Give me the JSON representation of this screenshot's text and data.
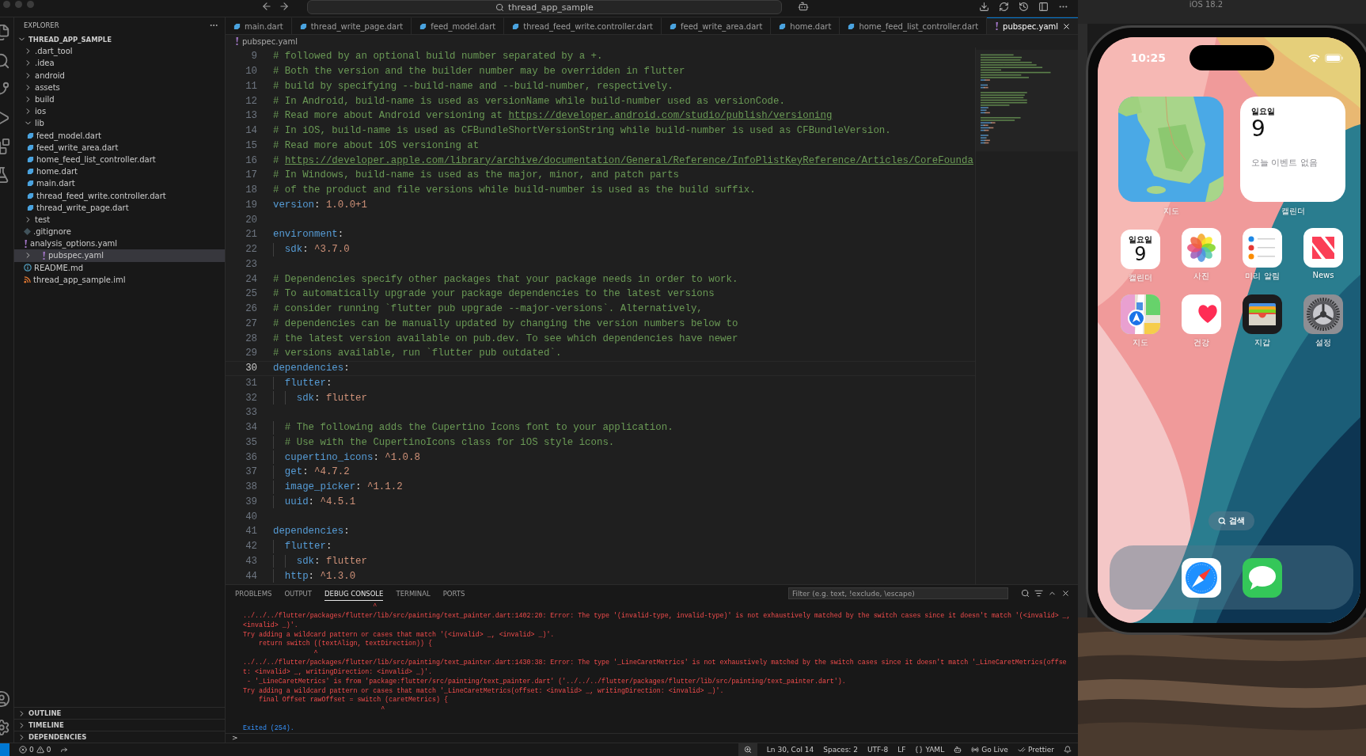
{
  "titlebar": {
    "search": "thread_app_sample"
  },
  "sidebar": {
    "title": "EXPLORER",
    "tree": [
      {
        "label": "THREAD_APP_SAMPLE",
        "kind": "root",
        "expanded": true,
        "selected": false,
        "children": [
          {
            "label": ".dart_tool",
            "kind": "folder",
            "expanded": false,
            "selected": false
          },
          {
            "label": ".idea",
            "kind": "folder",
            "expanded": false,
            "selected": false
          },
          {
            "label": "android",
            "kind": "folder",
            "expanded": false,
            "selected": false
          },
          {
            "label": "assets",
            "kind": "folder",
            "expanded": false,
            "selected": false
          },
          {
            "label": "build",
            "kind": "folder",
            "expanded": false,
            "selected": false
          },
          {
            "label": "ios",
            "kind": "folder",
            "expanded": false,
            "selected": false
          },
          {
            "label": "lib",
            "kind": "folder",
            "expanded": true,
            "selected": false,
            "children": [
              {
                "label": "feed_model.dart",
                "kind": "dart",
                "selected": false
              },
              {
                "label": "feed_write_area.dart",
                "kind": "dart",
                "selected": false
              },
              {
                "label": "home_feed_list_controller.dart",
                "kind": "dart",
                "selected": false
              },
              {
                "label": "home.dart",
                "kind": "dart",
                "selected": false
              },
              {
                "label": "main.dart",
                "kind": "dart",
                "selected": false
              },
              {
                "label": "thread_feed_write.controller.dart",
                "kind": "dart",
                "selected": false
              },
              {
                "label": "thread_write_page.dart",
                "kind": "dart",
                "selected": false
              }
            ]
          },
          {
            "label": "test",
            "kind": "folder",
            "expanded": false,
            "selected": false
          },
          {
            "label": ".gitignore",
            "kind": "git",
            "selected": false
          },
          {
            "label": "analysis_options.yaml",
            "kind": "yaml",
            "selected": false
          },
          {
            "label": "pubspec.yaml",
            "kind": "yaml",
            "expanded": false,
            "selected": true
          },
          {
            "label": "README.md",
            "kind": "info",
            "selected": false
          },
          {
            "label": "thread_app_sample.iml",
            "kind": "iml",
            "selected": false
          }
        ]
      }
    ],
    "sections": [
      {
        "label": "OUTLINE",
        "expanded": false
      },
      {
        "label": "TIMELINE",
        "expanded": false
      },
      {
        "label": "DEPENDENCIES",
        "expanded": false
      }
    ]
  },
  "tabs": [
    {
      "label": "main.dart",
      "kind": "dart",
      "selected": false
    },
    {
      "label": "thread_write_page.dart",
      "kind": "dart",
      "selected": false
    },
    {
      "label": "feed_model.dart",
      "kind": "dart",
      "selected": false
    },
    {
      "label": "thread_feed_write.controller.dart",
      "kind": "dart",
      "selected": false
    },
    {
      "label": "feed_write_area.dart",
      "kind": "dart",
      "selected": false
    },
    {
      "label": "home.dart",
      "kind": "dart",
      "selected": false
    },
    {
      "label": "home_feed_list_controller.dart",
      "kind": "dart",
      "selected": false
    },
    {
      "label": "pubspec.yaml",
      "kind": "yaml",
      "selected": true
    }
  ],
  "breadcrumb": [
    {
      "label": "pubspec.yaml",
      "kind": "yaml"
    }
  ],
  "editor": {
    "lines": [
      {
        "number": "9",
        "current": false,
        "tokens": [
          {
            "kind": "comment",
            "text": "# followed by an optional build number separated by a +."
          }
        ]
      },
      {
        "number": "10",
        "current": false,
        "tokens": [
          {
            "kind": "comment",
            "text": "# Both the version and the builder number may be overridden in flutter"
          }
        ]
      },
      {
        "number": "11",
        "current": false,
        "tokens": [
          {
            "kind": "comment",
            "text": "# build by specifying --build-name and --build-number, respectively."
          }
        ]
      },
      {
        "number": "12",
        "current": false,
        "tokens": [
          {
            "kind": "comment",
            "text": "# In Android, build-name is used as versionName while build-number used as versionCode."
          }
        ]
      },
      {
        "number": "13",
        "current": false,
        "tokens": [
          {
            "kind": "comment",
            "text": "# Read more about Android versioning at "
          },
          {
            "kind": "link",
            "text": "https://developer.android.com/studio/publish/versioning"
          }
        ]
      },
      {
        "number": "14",
        "current": false,
        "tokens": [
          {
            "kind": "comment",
            "text": "# In iOS, build-name is used as CFBundleShortVersionString while build-number is used as CFBundleVersion."
          }
        ]
      },
      {
        "number": "15",
        "current": false,
        "tokens": [
          {
            "kind": "comment",
            "text": "# Read more about iOS versioning at"
          }
        ]
      },
      {
        "number": "16",
        "current": false,
        "tokens": [
          {
            "kind": "comment",
            "text": "# "
          },
          {
            "kind": "link",
            "text": "https://developer.apple.com/library/archive/documentation/General/Reference/InfoPlistKeyReference/Articles/CoreFounda"
          }
        ]
      },
      {
        "number": "17",
        "current": false,
        "tokens": [
          {
            "kind": "comment",
            "text": "# In Windows, build-name is used as the major, minor, and patch parts"
          }
        ]
      },
      {
        "number": "18",
        "current": false,
        "tokens": [
          {
            "kind": "comment",
            "text": "# of the product and file versions while build-number is used as the build suffix."
          }
        ]
      },
      {
        "number": "19",
        "current": false,
        "tokens": [
          {
            "kind": "key",
            "text": "version"
          },
          {
            "kind": "punct",
            "text": ": "
          },
          {
            "kind": "value",
            "text": "1.0.0+1"
          }
        ]
      },
      {
        "number": "20",
        "current": false
      },
      {
        "number": "21",
        "current": false,
        "tokens": [
          {
            "kind": "key",
            "text": "environment"
          },
          {
            "kind": "punct",
            "text": ":"
          }
        ]
      },
      {
        "number": "22",
        "current": false,
        "tokens": [
          {
            "kind": "key",
            "text": "  sdk"
          },
          {
            "kind": "punct",
            "text": ": "
          },
          {
            "kind": "value",
            "text": "^3.7.0"
          }
        ]
      },
      {
        "number": "23",
        "current": false
      },
      {
        "number": "24",
        "current": false,
        "tokens": [
          {
            "kind": "comment",
            "text": "# Dependencies specify other packages that your package needs in order to work."
          }
        ]
      },
      {
        "number": "25",
        "current": false,
        "tokens": [
          {
            "kind": "comment",
            "text": "# To automatically upgrade your package dependencies to the latest versions"
          }
        ]
      },
      {
        "number": "26",
        "current": false,
        "tokens": [
          {
            "kind": "comment",
            "text": "# consider running `flutter pub upgrade --major-versions`. Alternatively,"
          }
        ]
      },
      {
        "number": "27",
        "current": false,
        "tokens": [
          {
            "kind": "comment",
            "text": "# dependencies can be manually updated by changing the version numbers below to"
          }
        ]
      },
      {
        "number": "28",
        "current": false,
        "tokens": [
          {
            "kind": "comment",
            "text": "# the latest version available on pub.dev. To see which dependencies have newer"
          }
        ]
      },
      {
        "number": "29",
        "current": false,
        "tokens": [
          {
            "kind": "comment",
            "text": "# versions available, run `flutter pub outdated`."
          }
        ]
      },
      {
        "number": "30",
        "current": true,
        "tokens": [
          {
            "kind": "key",
            "text": "dependencies"
          },
          {
            "kind": "punct",
            "text": ":"
          }
        ]
      },
      {
        "number": "31",
        "current": false,
        "tokens": [
          {
            "kind": "key",
            "text": "  flutter"
          },
          {
            "kind": "punct",
            "text": ":"
          }
        ]
      },
      {
        "number": "32",
        "current": false,
        "tokens": [
          {
            "kind": "key",
            "text": "    sdk"
          },
          {
            "kind": "punct",
            "text": ": "
          },
          {
            "kind": "value",
            "text": "flutter"
          }
        ]
      },
      {
        "number": "33",
        "current": false
      },
      {
        "number": "34",
        "current": false,
        "tokens": [
          {
            "kind": "comment",
            "text": "  # The following adds the Cupertino Icons font to your application."
          }
        ]
      },
      {
        "number": "35",
        "current": false,
        "tokens": [
          {
            "kind": "comment",
            "text": "  # Use with the CupertinoIcons class for iOS style icons."
          }
        ]
      },
      {
        "number": "36",
        "current": false,
        "tokens": [
          {
            "kind": "key",
            "text": "  cupertino_icons"
          },
          {
            "kind": "punct",
            "text": ": "
          },
          {
            "kind": "value",
            "text": "^1.0.8"
          }
        ]
      },
      {
        "number": "37",
        "current": false,
        "tokens": [
          {
            "kind": "key",
            "text": "  get"
          },
          {
            "kind": "punct",
            "text": ": "
          },
          {
            "kind": "value",
            "text": "^4.7.2"
          }
        ]
      },
      {
        "number": "38",
        "current": false,
        "tokens": [
          {
            "kind": "key",
            "text": "  image_picker"
          },
          {
            "kind": "punct",
            "text": ": "
          },
          {
            "kind": "value",
            "text": "^1.1.2"
          }
        ]
      },
      {
        "number": "39",
        "current": false,
        "tokens": [
          {
            "kind": "key",
            "text": "  uuid"
          },
          {
            "kind": "punct",
            "text": ": "
          },
          {
            "kind": "value",
            "text": "^4.5.1"
          }
        ]
      },
      {
        "number": "40",
        "current": false
      },
      {
        "number": "41",
        "current": false,
        "tokens": [
          {
            "kind": "key",
            "text": "dependencies"
          },
          {
            "kind": "punct",
            "text": ":"
          }
        ]
      },
      {
        "number": "42",
        "current": false,
        "tokens": [
          {
            "kind": "key",
            "text": "  flutter"
          },
          {
            "kind": "punct",
            "text": ":"
          }
        ]
      },
      {
        "number": "43",
        "current": false,
        "tokens": [
          {
            "kind": "key",
            "text": "    sdk"
          },
          {
            "kind": "punct",
            "text": ": "
          },
          {
            "kind": "value",
            "text": "flutter"
          }
        ]
      },
      {
        "number": "44",
        "current": false,
        "tokens": [
          {
            "kind": "key",
            "text": "  http"
          },
          {
            "kind": "punct",
            "text": ": "
          },
          {
            "kind": "value",
            "text": "^1.3.0"
          }
        ]
      }
    ]
  },
  "panel": {
    "tabs": [
      {
        "label": "PROBLEMS",
        "selected": false
      },
      {
        "label": "OUTPUT",
        "selected": false
      },
      {
        "label": "DEBUG CONSOLE",
        "selected": true
      },
      {
        "label": "TERMINAL",
        "selected": false
      },
      {
        "label": "PORTS",
        "selected": false
      }
    ],
    "filter": {
      "placeholder": "Filter (e.g. text, !exclude, \\escape)"
    },
    "lines": [
      {
        "kind": "error",
        "text": "                                 ^"
      },
      {
        "kind": "error",
        "text": "../../../flutter/packages/flutter/lib/src/painting/text_painter.dart:1402:20: Error: The type '(invalid-type, invalid-type)' is not exhaustively matched by the switch cases since it doesn't match '(<invalid> _,"
      },
      {
        "kind": "error",
        "text": "<invalid> _)'."
      },
      {
        "kind": "error",
        "text": "Try adding a wildcard pattern or cases that match '(<invalid> _, <invalid> _)'."
      },
      {
        "kind": "error",
        "text": "    return switch ((textAlign, textDirection)) {"
      },
      {
        "kind": "error",
        "text": "                  ^"
      },
      {
        "kind": "error",
        "text": "../../../flutter/packages/flutter/lib/src/painting/text_painter.dart:1430:38: Error: The type '_LineCaretMetrics' is not exhaustively matched by the switch cases since it doesn't match '_LineCaretMetrics(offse"
      },
      {
        "kind": "error",
        "text": "t: <invalid> _, writingDirection: <invalid> _)'."
      },
      {
        "kind": "error",
        "text": " - '_LineCaretMetrics' is from 'package:flutter/src/painting/text_painter.dart' ('../../../flutter/packages/flutter/lib/src/painting/text_painter.dart')."
      },
      {
        "kind": "error",
        "text": "Try adding a wildcard pattern or cases that match '_LineCaretMetrics(offset: <invalid> _, writingDirection: <invalid> _)'."
      },
      {
        "kind": "error",
        "text": "    final Offset rawOffset = switch (caretMetrics) {"
      },
      {
        "kind": "error",
        "text": "                                   ^"
      },
      {
        "kind": "blank"
      },
      {
        "kind": "info",
        "text": "Exited (254)."
      }
    ],
    "prompt": ">"
  },
  "status_bar": {
    "errors": "0",
    "warnings": "0",
    "items": [
      {
        "kind": "plain",
        "text": "Ln 30, Col 14"
      },
      {
        "kind": "plain",
        "text": "Spaces: 2"
      },
      {
        "kind": "plain",
        "text": "UTF-8"
      },
      {
        "kind": "plain",
        "text": "LF"
      },
      {
        "kind": "language",
        "text": "YAML"
      },
      {
        "kind": "live",
        "text": "Go Live"
      },
      {
        "kind": "prettier",
        "text": "Prettier"
      }
    ]
  },
  "simulator": {
    "title": "iOS 18.2",
    "phone": {
      "time": "10:25",
      "widgets": [
        {
          "kind": "map",
          "label": "지도"
        },
        {
          "kind": "calendar",
          "label": "캘린더",
          "weekday": "일요일",
          "day": "9",
          "note": "오늘 이벤트 없음"
        }
      ],
      "apps": [
        {
          "kind": "calendar",
          "label": "캘린더",
          "weekday": "일요일",
          "day": "9"
        },
        {
          "kind": "photos",
          "label": "사진"
        },
        {
          "kind": "reminders",
          "label": "미리 알림"
        },
        {
          "kind": "news",
          "label": "News"
        },
        {
          "kind": "maps",
          "label": "지도"
        },
        {
          "kind": "health",
          "label": "건강"
        },
        {
          "kind": "wallet",
          "label": "지갑"
        },
        {
          "kind": "settings",
          "label": "설정"
        }
      ],
      "search": "검색",
      "dock": [
        {
          "kind": "safari"
        },
        {
          "kind": "messages"
        }
      ]
    }
  }
}
